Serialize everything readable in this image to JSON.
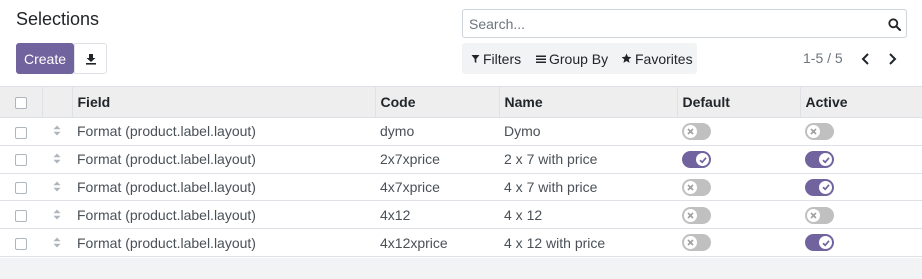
{
  "header": {
    "title": "Selections",
    "create_label": "Create",
    "download_icon": "download-icon"
  },
  "search": {
    "placeholder": "Search...",
    "value": ""
  },
  "filters": {
    "filters_label": "Filters",
    "group_by_label": "Group By",
    "favorites_label": "Favorites"
  },
  "pager": {
    "value": "1-5 / 5"
  },
  "table": {
    "columns": [
      "Field",
      "Code",
      "Name",
      "Default",
      "Active"
    ],
    "rows": [
      {
        "field": "Format (product.label.layout)",
        "code": "dymo",
        "name": "Dymo",
        "default": false,
        "active": false
      },
      {
        "field": "Format (product.label.layout)",
        "code": "2x7xprice",
        "name": "2 x 7 with price",
        "default": true,
        "active": true
      },
      {
        "field": "Format (product.label.layout)",
        "code": "4x7xprice",
        "name": "4 x 7 with price",
        "default": false,
        "active": true
      },
      {
        "field": "Format (product.label.layout)",
        "code": "4x12",
        "name": "4 x 12",
        "default": false,
        "active": false
      },
      {
        "field": "Format (product.label.layout)",
        "code": "4x12xprice",
        "name": "4 x 12 with price",
        "default": false,
        "active": true
      }
    ]
  },
  "colors": {
    "primary": "#71639e",
    "toggle_off": "#c0c0c0",
    "header_bg": "#eeeeee"
  }
}
